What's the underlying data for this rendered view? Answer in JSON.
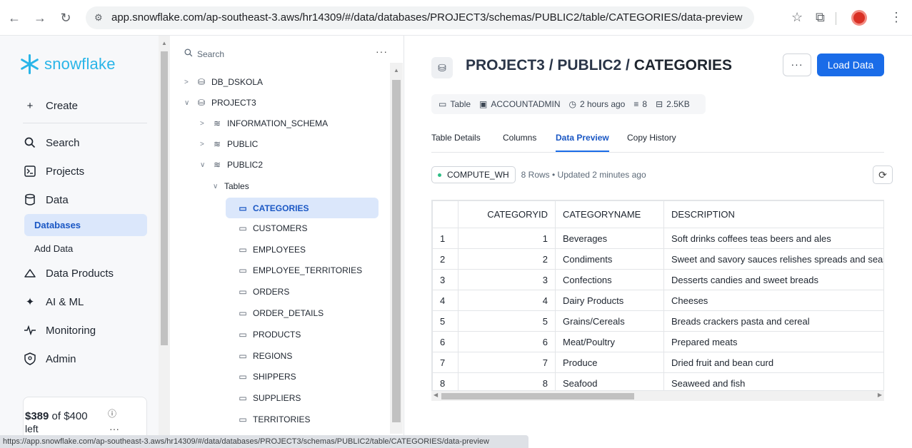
{
  "browser": {
    "url": "app.snowflake.com/ap-southeast-3.aws/hr14309/#/data/databases/PROJECT3/schemas/PUBLIC2/table/CATEGORIES/data-preview",
    "status_url": "https://app.snowflake.com/ap-southeast-3.aws/hr14309/#/data/databases/PROJECT3/schemas/PUBLIC2/table/CATEGORIES/data-preview"
  },
  "nav": {
    "logo": "snowflake",
    "create": "Create",
    "search": "Search",
    "projects": "Projects",
    "data": "Data",
    "databases": "Databases",
    "add_data": "Add Data",
    "data_products": "Data Products",
    "ai_ml": "AI & ML",
    "monitoring": "Monitoring",
    "admin": "Admin",
    "credit_amount": "$389",
    "credit_of": " of $400",
    "credit_left": "left",
    "accent": "#29b5e8"
  },
  "tree": {
    "search_placeholder": "Search",
    "more": "···",
    "db1": "DB_DSKOLA",
    "db2": "PROJECT3",
    "schema1": "INFORMATION_SCHEMA",
    "schema2": "PUBLIC",
    "schema3": "PUBLIC2",
    "tables_folder": "Tables",
    "tables": [
      "CATEGORIES",
      "CUSTOMERS",
      "EMPLOYEES",
      "EMPLOYEE_TERRITORIES",
      "ORDERS",
      "ORDER_DETAILS",
      "PRODUCTS",
      "REGIONS",
      "SHIPPERS",
      "SUPPLIERS",
      "TERRITORIES"
    ]
  },
  "main": {
    "breadcrumb_prefix": "PROJECT3 / PUBLIC2 / ",
    "breadcrumb_last": "CATEGORIES",
    "more": "···",
    "load_data": "Load Data",
    "meta_type": "Table",
    "meta_owner": "ACCOUNTADMIN",
    "meta_time": "2 hours ago",
    "meta_cols": "8",
    "meta_size": "2.5KB",
    "tabs": [
      "Table Details",
      "Columns",
      "Data Preview",
      "Copy History"
    ],
    "warehouse": "COMPUTE_WH",
    "rows_info": "8 Rows • Updated 2 minutes ago",
    "columns": [
      "CATEGORYID",
      "CATEGORYNAME",
      "DESCRIPTION"
    ],
    "rows": [
      [
        "1",
        "1",
        "Beverages",
        "Soft drinks coffees teas beers and ales"
      ],
      [
        "2",
        "2",
        "Condiments",
        "Sweet and savory sauces relishes spreads and seasonings"
      ],
      [
        "3",
        "3",
        "Confections",
        "Desserts candies and sweet breads"
      ],
      [
        "4",
        "4",
        "Dairy Products",
        "Cheeses"
      ],
      [
        "5",
        "5",
        "Grains/Cereals",
        "Breads crackers pasta and cereal"
      ],
      [
        "6",
        "6",
        "Meat/Poultry",
        "Prepared meats"
      ],
      [
        "7",
        "7",
        "Produce",
        "Dried fruit and bean curd"
      ],
      [
        "8",
        "8",
        "Seafood",
        "Seaweed and fish"
      ]
    ],
    "primary": "#1a6ce8"
  }
}
